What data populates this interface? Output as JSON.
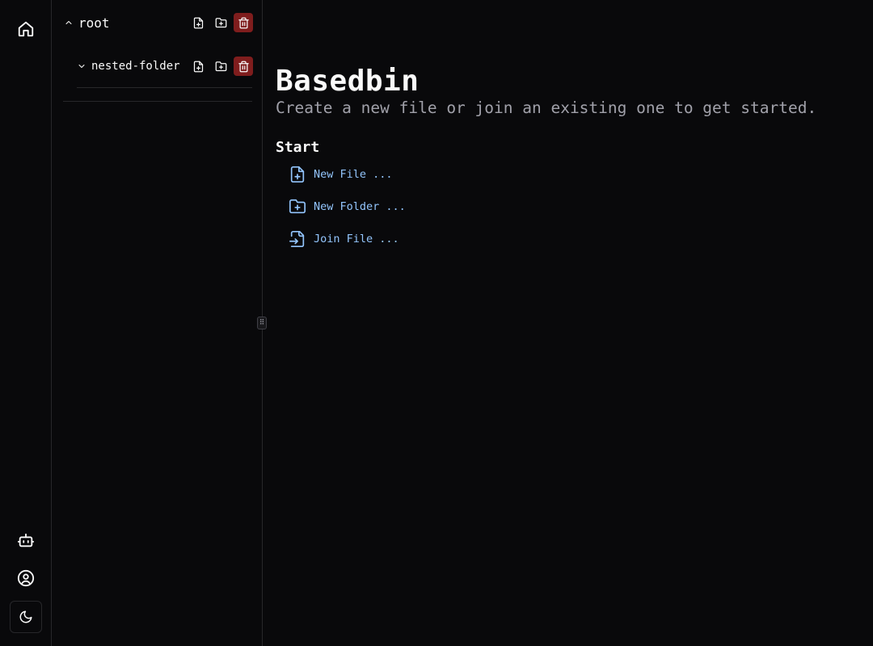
{
  "rail": {
    "icons": [
      "home-icon",
      "bot-icon",
      "user-circle-icon",
      "moon-icon"
    ]
  },
  "tree": {
    "root": {
      "label": "root",
      "expanded": true
    },
    "nested": {
      "label": "nested-folder",
      "expanded": true
    }
  },
  "main": {
    "title": "Basedbin",
    "subtitle": "Create a new file or join an existing one to get started.",
    "start_heading": "Start",
    "actions": [
      {
        "label": "New File ...",
        "icon": "file-plus-icon"
      },
      {
        "label": "New Folder ...",
        "icon": "folder-plus-icon"
      },
      {
        "label": "Join File ...",
        "icon": "file-input-icon"
      }
    ]
  },
  "colors": {
    "background": "#09090b",
    "border": "#27272a",
    "accent": "#93c5fd",
    "danger": "#7f1d1d",
    "muted": "#a1a1aa"
  }
}
